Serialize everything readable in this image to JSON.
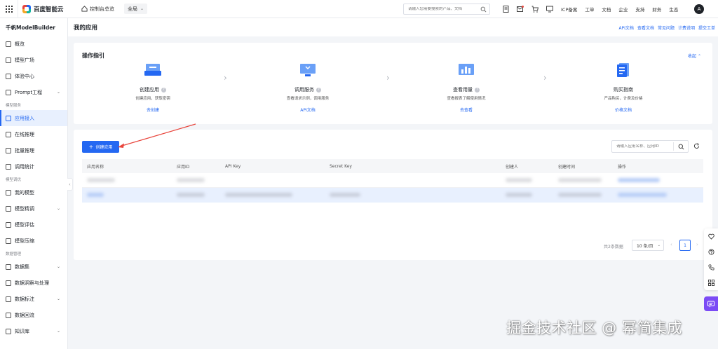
{
  "topbar": {
    "brand": "百度智能云",
    "console": "控制台总览",
    "region": "全局",
    "search_placeholder": "请输入您需要搜索的产品、文档",
    "links": [
      "ICP备案",
      "工单",
      "文档",
      "企业",
      "支持",
      "财务",
      "生态"
    ],
    "avatar": "A"
  },
  "sidebar": {
    "title": "千帆ModelBuilder",
    "top_items": [
      {
        "label": "概览"
      },
      {
        "label": "模型广场"
      },
      {
        "label": "体验中心"
      },
      {
        "label": "Prompt工程"
      }
    ],
    "groups": [
      {
        "label": "模型服务",
        "items": [
          {
            "label": "应用接入",
            "active": true
          },
          {
            "label": "在线推理"
          },
          {
            "label": "批量推理"
          },
          {
            "label": "调用统计"
          }
        ]
      },
      {
        "label": "模型调优",
        "items": [
          {
            "label": "我的模型"
          },
          {
            "label": "模型精调"
          },
          {
            "label": "模型评估"
          },
          {
            "label": "模型压缩"
          }
        ]
      },
      {
        "label": "数据管理",
        "items": [
          {
            "label": "数据集"
          },
          {
            "label": "数据洞察与处理"
          },
          {
            "label": "数据标注"
          },
          {
            "label": "数据回流"
          },
          {
            "label": "知识库"
          }
        ]
      }
    ]
  },
  "page": {
    "title": "我的应用",
    "links": [
      "API文档",
      "查看文档",
      "常见问题",
      "计费说明",
      "提交工单"
    ]
  },
  "guide": {
    "title": "操作指引",
    "collapse": "收起",
    "steps": [
      {
        "name": "创建应用",
        "desc": "创建应用，获取密钥",
        "link": "去创建"
      },
      {
        "name": "调用服务",
        "desc": "查看请求示例，调用服务",
        "link": "API文档"
      },
      {
        "name": "查看用量",
        "desc": "查看报表了解使用情况",
        "link": "去查看"
      },
      {
        "name": "购买指南",
        "desc": "产品购买，计费及价格",
        "link": "价格文档"
      }
    ]
  },
  "apps": {
    "create_button": "创建应用",
    "search_placeholder": "请输入应用名称、应用ID",
    "columns": [
      "应用名称",
      "应用ID",
      "API Key",
      "Secret Key",
      "创建人",
      "创建时间",
      "操作"
    ],
    "total": "共2条数据",
    "page_size": "10 条/页",
    "current_page": "1"
  },
  "watermark": "掘金技术社区 @ 幂简集成",
  "colors": {
    "accent": "#2468f2",
    "chat": "#7b4bf5",
    "annotation": "#e8453c"
  }
}
